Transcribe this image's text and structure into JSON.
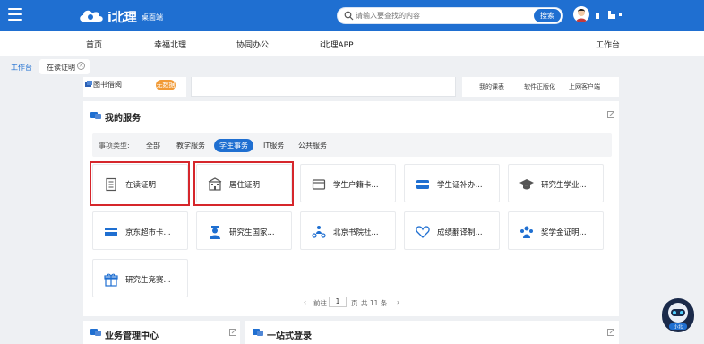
{
  "header": {
    "app_name": "i北理",
    "app_sub": "桌面端",
    "search_placeholder": "请输入要查找的内容",
    "search_button": "搜索",
    "brand_color": "#1f6fd1"
  },
  "nav": {
    "items": [
      "首页",
      "幸福北理",
      "协同办公",
      "i北理APP",
      "工作台"
    ]
  },
  "tabs": {
    "workspace": "工作台",
    "current": "在读证明"
  },
  "top_card": {
    "book_label": "图书借阅",
    "badge": "无数据",
    "links": [
      "我的课表",
      "软件正版化",
      "上网客户端"
    ]
  },
  "services": {
    "title": "我的服务",
    "filter_label": "事项类型:",
    "filters": [
      "全部",
      "教学服务",
      "学生事务",
      "IT服务",
      "公共服务"
    ],
    "active_filter": "学生事务",
    "items": [
      {
        "label": "在读证明",
        "icon": "document-icon"
      },
      {
        "label": "居住证明",
        "icon": "building-icon"
      },
      {
        "label": "学生户籍卡...",
        "icon": "id-card-icon"
      },
      {
        "label": "学生证补办...",
        "icon": "card-icon"
      },
      {
        "label": "研究生学业...",
        "icon": "graduation-cap-icon"
      },
      {
        "label": "京东超市卡...",
        "icon": "card-icon"
      },
      {
        "label": "研究生国家...",
        "icon": "person-icon"
      },
      {
        "label": "北京书院社...",
        "icon": "people-icon"
      },
      {
        "label": "成绩翻译制...",
        "icon": "heart-hands-icon"
      },
      {
        "label": "奖学金证明...",
        "icon": "group-icon"
      },
      {
        "label": "研究生竞赛...",
        "icon": "gift-icon"
      }
    ],
    "pager": {
      "prev": "‹",
      "before": "前往",
      "page": "1",
      "after": "页",
      "total": "共 11 条",
      "next": "›"
    }
  },
  "bottom": {
    "left_title": "业务管理中心",
    "right_title": "一站式登录"
  },
  "robot_label": "小北"
}
